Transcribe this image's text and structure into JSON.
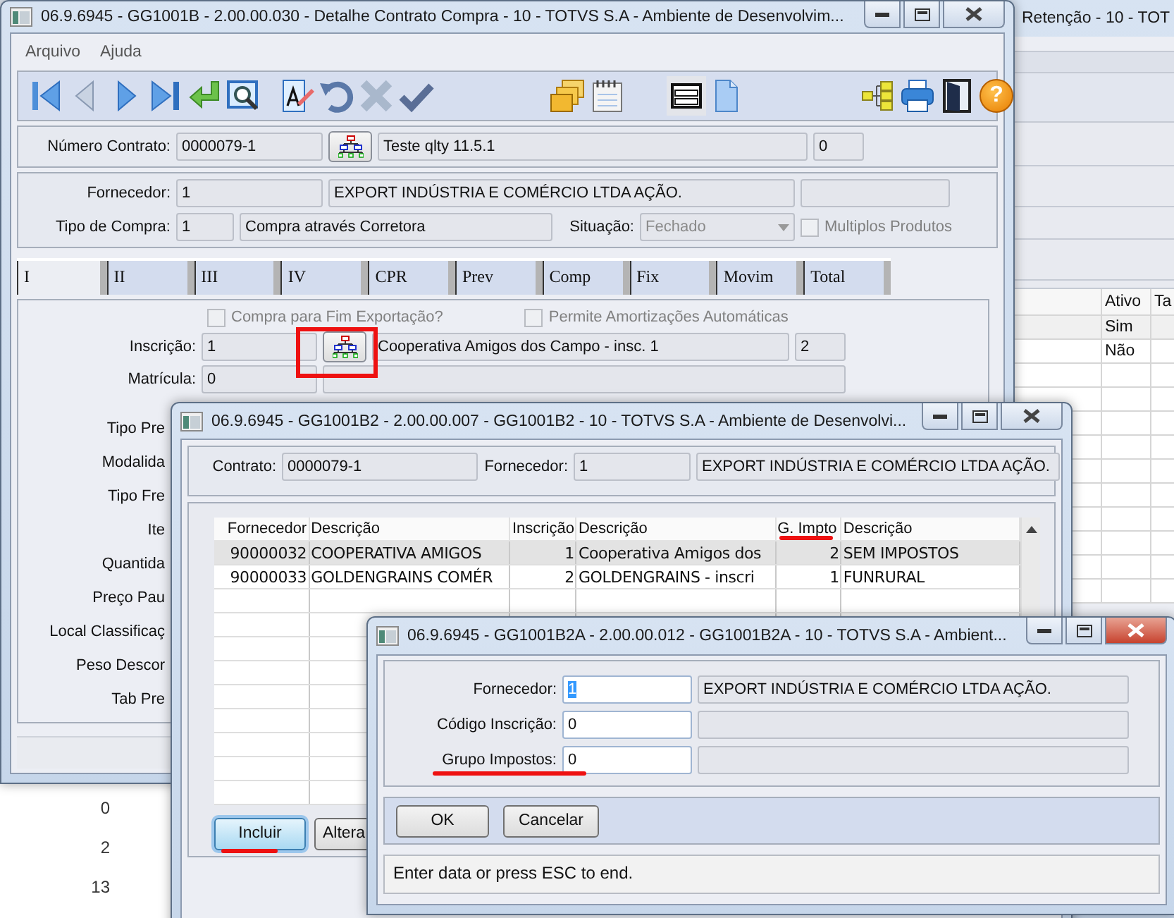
{
  "background_window": {
    "title": "Retenção - 10 - TOT",
    "table": {
      "columns": [
        "Ativo",
        "Ta"
      ],
      "rows": [
        {
          "cells": [
            "Sim"
          ]
        },
        {
          "cells": [
            "Não"
          ]
        }
      ]
    },
    "column_values": [
      "0",
      "2",
      "13"
    ]
  },
  "main_window": {
    "title": "06.9.6945 - GG1001B - 2.00.00.030 - Detalhe Contrato Compra - 10 - TOTVS S.A - Ambiente de Desenvolvim...",
    "menu": [
      "Arquivo",
      "Ajuda"
    ],
    "help_glyph": "?",
    "contract": {
      "label": "Número Contrato:",
      "number": "0000079-1",
      "description": "Teste qlty 11.5.1",
      "sequence": "0"
    },
    "supplier": {
      "label": "Fornecedor:",
      "code": "1",
      "name": "EXPORT INDÚSTRIA E COMÉRCIO LTDA AÇÃO."
    },
    "purchase_type": {
      "label": "Tipo de Compra:",
      "code": "1",
      "name": "Compra através Corretora"
    },
    "status": {
      "label": "Situação:",
      "value": "Fechado",
      "disabled": true
    },
    "multiple_products": {
      "label": "Multiplos Produtos",
      "checked": false,
      "disabled": true
    },
    "tabs": [
      {
        "label": "I",
        "selected": true
      },
      {
        "label": "II",
        "selected": false
      },
      {
        "label": "III",
        "selected": false
      },
      {
        "label": "IV",
        "selected": false
      },
      {
        "label": "CPR",
        "selected": false
      },
      {
        "label": "Prev",
        "selected": false
      },
      {
        "label": "Comp",
        "selected": false
      },
      {
        "label": "Fix",
        "selected": false
      },
      {
        "label": "Movim",
        "selected": false
      },
      {
        "label": "Total",
        "selected": false
      }
    ],
    "checkboxes": [
      {
        "label": "Compra para Fim Exportação?",
        "checked": false,
        "disabled": true
      },
      {
        "label": "Permite Amortizações Automáticas",
        "checked": false,
        "disabled": true
      }
    ],
    "inscription": {
      "label": "Inscrição:",
      "code": "1",
      "name": "Cooperativa Amigos dos Campo - insc. 1",
      "number": "2"
    },
    "registration": {
      "label": "Matrícula:",
      "value": "0"
    },
    "partial_labels": [
      "Tipo Pre",
      "Modalida",
      "Tipo Fre",
      "Ite",
      "Quantida",
      "Preço Pau",
      "Local Classificaç",
      "Peso Descor",
      "Tab Pre"
    ]
  },
  "list_window": {
    "title": "06.9.6945 - GG1001B2 - 2.00.00.007 - GG1001B2 - 10 - TOTVS S.A - Ambiente de Desenvolvi...",
    "contract_label": "Contrato:",
    "contract": "0000079-1",
    "supplier_label": "Fornecedor:",
    "supplier_code": "1",
    "supplier_name": "EXPORT INDÚSTRIA E COMÉRCIO LTDA AÇÃO.",
    "table": {
      "columns": [
        "Fornecedor",
        "Descrição",
        "Inscrição",
        "Descrição",
        "G. Impto",
        "Descrição"
      ],
      "rows": [
        {
          "cells": [
            "90000032",
            "COOPERATIVA AMIGOS",
            "1",
            "Cooperativa Amigos dos",
            "2",
            "SEM IMPOSTOS"
          ],
          "selected": true
        },
        {
          "cells": [
            "90000033",
            "GOLDENGRAINS COMÉR",
            "2",
            "GOLDENGRAINS - inscri",
            "1",
            "FUNRURAL"
          ],
          "selected": false
        }
      ]
    },
    "buttons": [
      {
        "label": "Incluir",
        "focused": true
      },
      {
        "label": "Altera",
        "focused": false
      }
    ]
  },
  "edit_window": {
    "title": "06.9.6945 - GG1001B2A - 2.00.00.012 - GG1001B2A - 10 - TOTVS S.A - Ambient...",
    "fields": [
      {
        "label": "Fornecedor:",
        "value": "1",
        "description": "EXPORT INDÚSTRIA E COMÉRCIO LTDA AÇÃO.",
        "text_selected": true
      },
      {
        "label": "Código Inscrição:",
        "value": "0",
        "text_selected": false
      },
      {
        "label": "Grupo Impostos:",
        "value": "0",
        "text_selected": false
      }
    ],
    "buttons": [
      "OK",
      "Cancelar"
    ],
    "status": "Enter data or press ESC to end."
  },
  "annotations": [
    {
      "kind": "frame"
    },
    {
      "kind": "underline"
    },
    {
      "kind": "underline"
    },
    {
      "kind": "underline"
    }
  ]
}
